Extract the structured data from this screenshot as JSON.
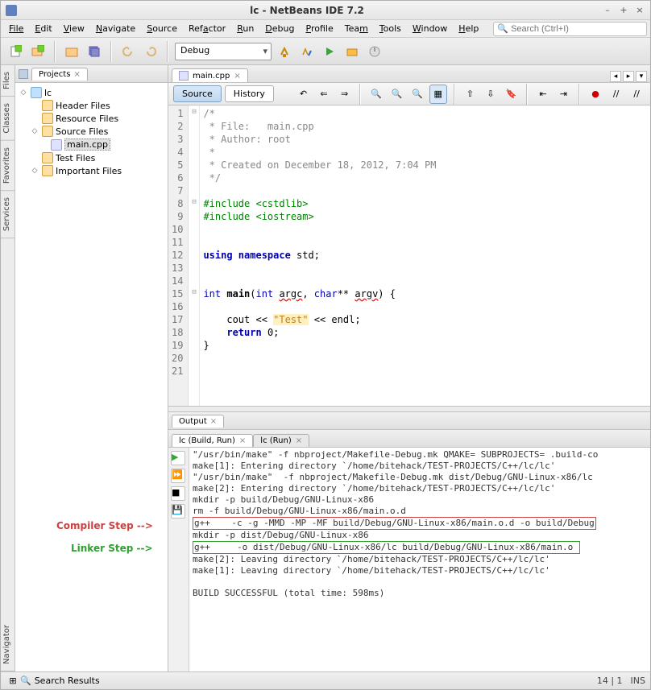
{
  "titlebar": {
    "title": "lc - NetBeans IDE 7.2"
  },
  "menu": [
    "File",
    "Edit",
    "View",
    "Navigate",
    "Source",
    "Refactor",
    "Run",
    "Debug",
    "Profile",
    "Team",
    "Tools",
    "Window",
    "Help"
  ],
  "search_placeholder": "Search (Ctrl+I)",
  "toolbar_combo": "Debug",
  "left_tabs": [
    "Files",
    "Classes",
    "Favorites",
    "Services"
  ],
  "nav_tab": "Navigator",
  "projects": {
    "tabname": "Projects",
    "root": "lc",
    "folders": [
      "Header Files",
      "Resource Files",
      "Source Files",
      "Test Files",
      "Important Files"
    ],
    "file": "main.cpp"
  },
  "editor": {
    "tabname": "main.cpp",
    "segments": [
      "Source",
      "History"
    ],
    "lines": [
      {
        "n": 1,
        "c": "/*",
        "cls": "cm",
        "fold": "⊟"
      },
      {
        "n": 2,
        "c": " * File:   main.cpp",
        "cls": "cm"
      },
      {
        "n": 3,
        "c": " * Author: root",
        "cls": "cm"
      },
      {
        "n": 4,
        "c": " *",
        "cls": "cm"
      },
      {
        "n": 5,
        "c": " * Created on December 18, 2012, 7:04 PM",
        "cls": "cm"
      },
      {
        "n": 6,
        "c": " */",
        "cls": "cm"
      },
      {
        "n": 7,
        "c": ""
      },
      {
        "n": 8,
        "html": "<span class='pp'>#include </span><span class='pp'>&lt;cstdlib&gt;</span>",
        "fold": "⊟"
      },
      {
        "n": 9,
        "html": "<span class='pp'>#include </span><span class='pp'>&lt;iostream&gt;</span>"
      },
      {
        "n": 10,
        "c": ""
      },
      {
        "n": 11,
        "c": ""
      },
      {
        "n": 12,
        "html": "<span class='kw'>using namespace</span> std;"
      },
      {
        "n": 13,
        "c": ""
      },
      {
        "n": 14,
        "c": ""
      },
      {
        "n": 15,
        "html": "<span class='ty'>int</span> <span class='id'>main</span>(<span class='ty'>int</span> <span class='redw'>argc</span>, <span class='ty'>char</span>** <span class='redw'>argv</span>) {",
        "fold": "⊟"
      },
      {
        "n": 16,
        "c": ""
      },
      {
        "n": 17,
        "html": "    cout &lt;&lt; <span class='st'>\"Test\"</span> &lt;&lt; endl;"
      },
      {
        "n": 18,
        "html": "    <span class='kw'>return</span> 0;"
      },
      {
        "n": 19,
        "c": "}"
      },
      {
        "n": 20,
        "c": ""
      },
      {
        "n": 21,
        "c": ""
      }
    ]
  },
  "output": {
    "tabname": "Output",
    "subtabs": [
      "lc (Build, Run)",
      "lc (Run)"
    ],
    "lines": [
      "\"/usr/bin/make\" -f nbproject/Makefile-Debug.mk QMAKE= SUBPROJECTS= .build-co",
      "make[1]: Entering directory `/home/bitehack/TEST-PROJECTS/C++/lc/lc'",
      "\"/usr/bin/make\"  -f nbproject/Makefile-Debug.mk dist/Debug/GNU-Linux-x86/lc",
      "make[2]: Entering directory `/home/bitehack/TEST-PROJECTS/C++/lc/lc'",
      "mkdir -p build/Debug/GNU-Linux-x86",
      "rm -f build/Debug/GNU-Linux-x86/main.o.d",
      "g++    -c -g -MMD -MP -MF build/Debug/GNU-Linux-x86/main.o.d -o build/Debug",
      "mkdir -p dist/Debug/GNU-Linux-x86",
      "g++     -o dist/Debug/GNU-Linux-x86/lc build/Debug/GNU-Linux-x86/main.o ",
      "make[2]: Leaving directory `/home/bitehack/TEST-PROJECTS/C++/lc/lc'",
      "make[1]: Leaving directory `/home/bitehack/TEST-PROJECTS/C++/lc/lc'",
      "",
      "BUILD SUCCESSFUL (total time: 598ms)"
    ],
    "annot_compiler": "Compiler Step -->",
    "annot_linker": "Linker Step -->"
  },
  "statusbar": {
    "searchres": "Search Results",
    "pos": "14 | 1",
    "ins": "INS"
  }
}
